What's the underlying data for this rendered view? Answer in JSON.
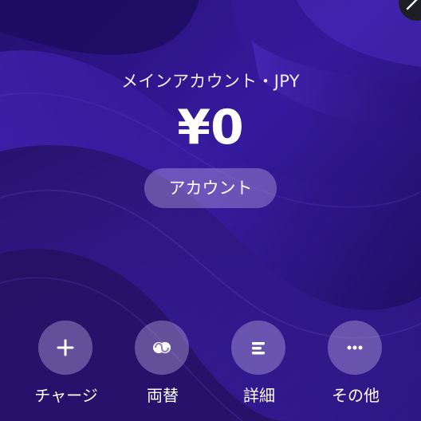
{
  "account": {
    "title": "メインアカウント・JPY",
    "balance": "¥0",
    "account_button": "アカウント"
  },
  "actions": [
    {
      "label": "チャージ",
      "icon": "plus-icon"
    },
    {
      "label": "両替",
      "icon": "exchange-icon"
    },
    {
      "label": "詳細",
      "icon": "details-icon"
    },
    {
      "label": "その他",
      "icon": "more-icon"
    }
  ],
  "colors": {
    "background": "#2a1380",
    "text": "#ffffff",
    "button_fill": "#c6b8e9"
  }
}
